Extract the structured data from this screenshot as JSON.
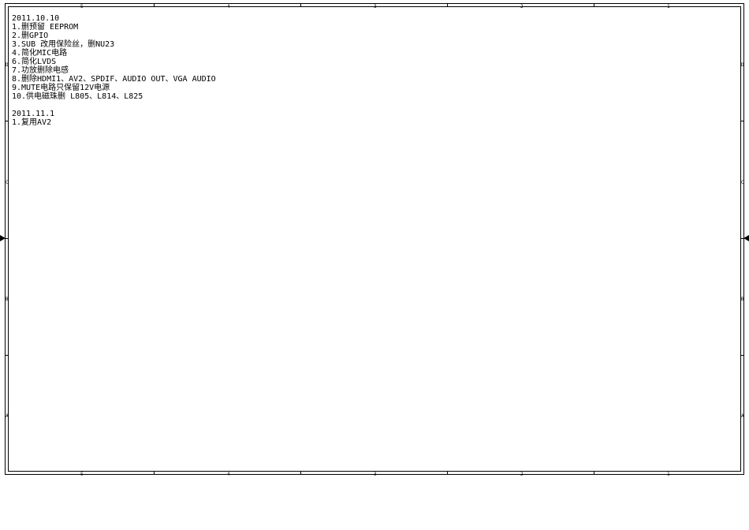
{
  "frame": {
    "cols": [
      "5",
      "4",
      "3",
      "2",
      "1"
    ],
    "rows": [
      "D",
      "C",
      "B",
      "A"
    ]
  },
  "notes": {
    "block1_date": "2011.10.10",
    "block1_items": [
      "1.删预留 EEPROM",
      "2.删GPIO",
      "3.SUB 改用保险丝，删NU23",
      "4.简化MIC电路",
      "6.简化LVDS",
      "7.功放删除电感",
      "8.删除HDMI1、AV2、SPDIF、AUDIO OUT、VGA AUDIO",
      "9.MUTE电路只保留12V电源",
      "10.供电磁珠删 L805、L814、L825"
    ],
    "block2_date": "2011.11.1",
    "block2_items": [
      "1.复用AV2"
    ]
  }
}
